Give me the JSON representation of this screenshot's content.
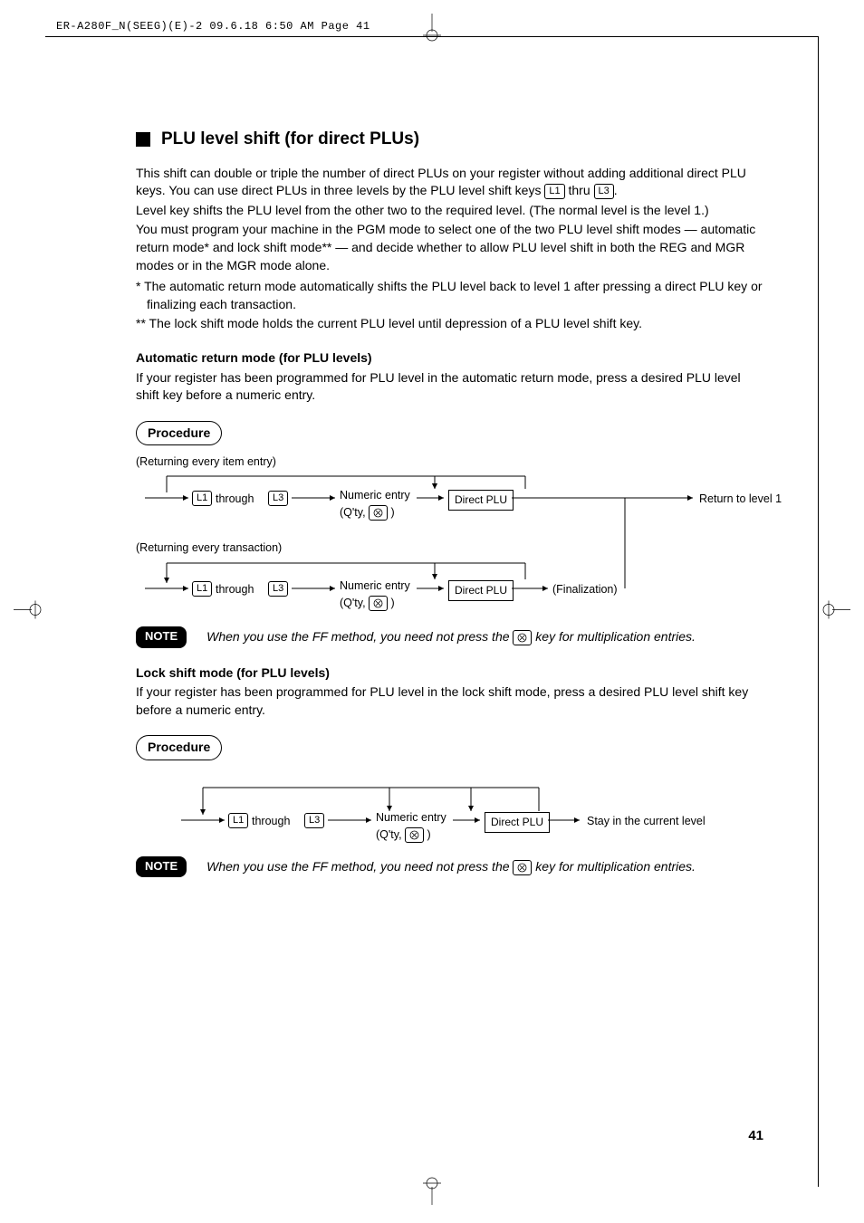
{
  "header": "ER-A280F_N(SEEG)(E)-2  09.6.18 6:50 AM  Page 41",
  "title": "PLU level shift (for direct PLUs)",
  "intro_line1_a": "This shift can double or triple the number of direct PLUs on your register without adding additional direct PLU keys. You can use direct PLUs in three levels by the PLU level shift keys ",
  "intro_line1_b": " thru ",
  "intro_line1_c": ".",
  "intro_line2": "Level key shifts the PLU level from the other two to the required level. (The normal level is the level 1.)",
  "intro_line3": "You must program your machine in the PGM mode to select one of the two PLU level shift modes — automatic return mode* and lock shift mode** — and decide whether to allow PLU level shift in both the REG and MGR modes or in the MGR mode alone.",
  "footnote1": "* The automatic return mode automatically shifts the PLU level back to level 1 after pressing a direct PLU key or finalizing each transaction.",
  "footnote2": "** The lock shift mode holds the current PLU level until depression of a PLU level shift key.",
  "auto_heading": "Automatic return mode (for PLU levels)",
  "auto_desc": "If your register has been programmed for PLU level in the automatic return mode, press a desired PLU level shift key before a numeric entry.",
  "procedure_label": "Procedure",
  "returning_item": "(Returning every item entry)",
  "returning_trans": "(Returning every transaction)",
  "through": " through ",
  "numeric_entry": "Numeric entry",
  "qty_prefix": "(Q'ty, ",
  "qty_suffix": " )",
  "direct_plu": "Direct PLU",
  "return_level1": "Return to level 1",
  "finalization": "(Finalization)",
  "stay_current": "Stay in the current level",
  "note_label": "NOTE",
  "note_text_a": "When you use the FF method, you need not press the ",
  "note_text_b": " key for multiplication entries.",
  "lock_heading": "Lock shift mode (for PLU levels)",
  "lock_desc": "If your register has been programmed for PLU level in the lock shift mode, press a desired PLU level shift key before a numeric entry.",
  "keys": {
    "L1": "L1",
    "L3": "L3"
  },
  "page_number": "41"
}
